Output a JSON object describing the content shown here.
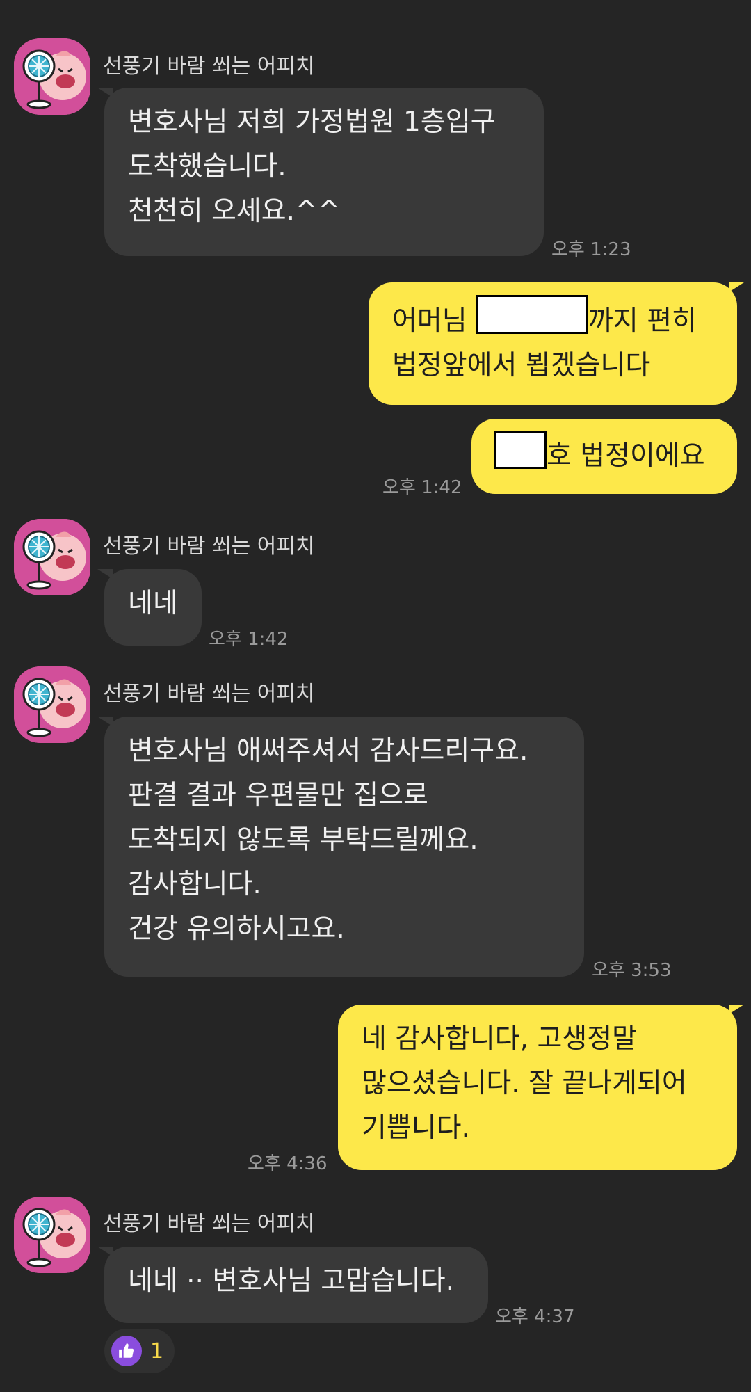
{
  "sender_name": "선풍기 바람 쐬는 어피치",
  "messages": [
    {
      "lines": [
        "변호사님 저희 가정법원 1층입구",
        "도착했습니다.",
        "천천히 오세요.^^"
      ],
      "time": "오후 1:23"
    },
    {
      "line1_prefix": "어머님 ",
      "line1_suffix": "까지 편히",
      "line2": "법정앞에서 뵙겠습니다"
    },
    {
      "suffix": "호 법정이에요",
      "time": "오후 1:42"
    },
    {
      "lines": [
        "네네"
      ],
      "time": "오후 1:42"
    },
    {
      "lines": [
        "변호사님 애써주셔서 감사드리구요.",
        "판결 결과 우편물만 집으로",
        "도착되지 않도록 부탁드릴께요.",
        "감사합니다.",
        "건강 유의하시고요."
      ],
      "time": "오후 3:53"
    },
    {
      "lines": [
        "네 감사합니다, 고생정말",
        "많으셨습니다. 잘 끝나게되어",
        "기쁩니다."
      ],
      "time": "오후 4:36"
    },
    {
      "lines": [
        "네네 ·· 변호사님 고맙습니다."
      ],
      "time": "오후 4:37"
    }
  ],
  "reaction": {
    "icon": "thumbs-up-icon",
    "count": "1",
    "color": "#8a4dde"
  },
  "colors": {
    "background": "#252525",
    "incoming_bubble": "#393939",
    "outgoing_bubble": "#fde84a",
    "avatar": "#d24f9a"
  }
}
